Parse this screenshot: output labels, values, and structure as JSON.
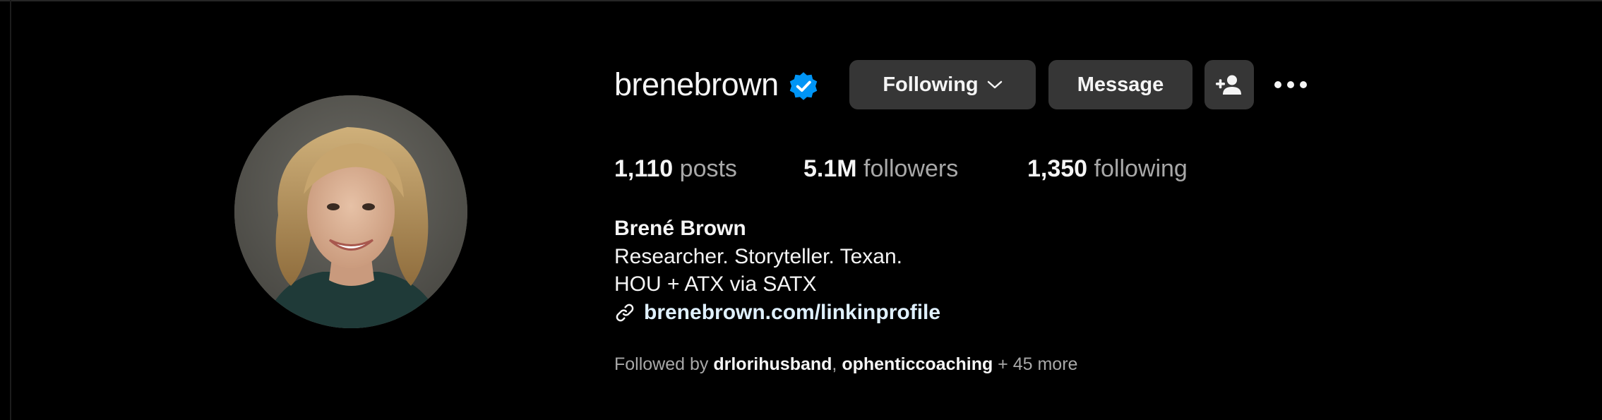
{
  "profile": {
    "username": "brenebrown",
    "verified_icon": "verified-badge-icon",
    "avatar_icon": "profile-photo"
  },
  "actions": {
    "following_label": "Following",
    "message_label": "Message",
    "add_user_icon": "person-plus-icon",
    "more_icon": "more-options-icon"
  },
  "stats": {
    "posts_count": "1,110",
    "posts_label": "posts",
    "followers_count": "5.1M",
    "followers_label": "followers",
    "following_count": "1,350",
    "following_label": "following"
  },
  "bio": {
    "full_name": "Brené Brown",
    "line1": "Researcher. Storyteller. Texan.",
    "line2": "HOU + ATX via SATX",
    "link": "brenebrown.com/linkinprofile"
  },
  "followed_by": {
    "prefix": "Followed by ",
    "users": [
      "drlorihusband",
      "ophenticcoaching"
    ],
    "separator": ", ",
    "more": " + 45 more"
  },
  "colors": {
    "background": "#000000",
    "button_bg": "#363636",
    "primary_text": "#f5f5f5",
    "secondary_text": "#a8a8a8",
    "verified_blue": "#0095f6",
    "link_text": "#e0f1ff"
  }
}
